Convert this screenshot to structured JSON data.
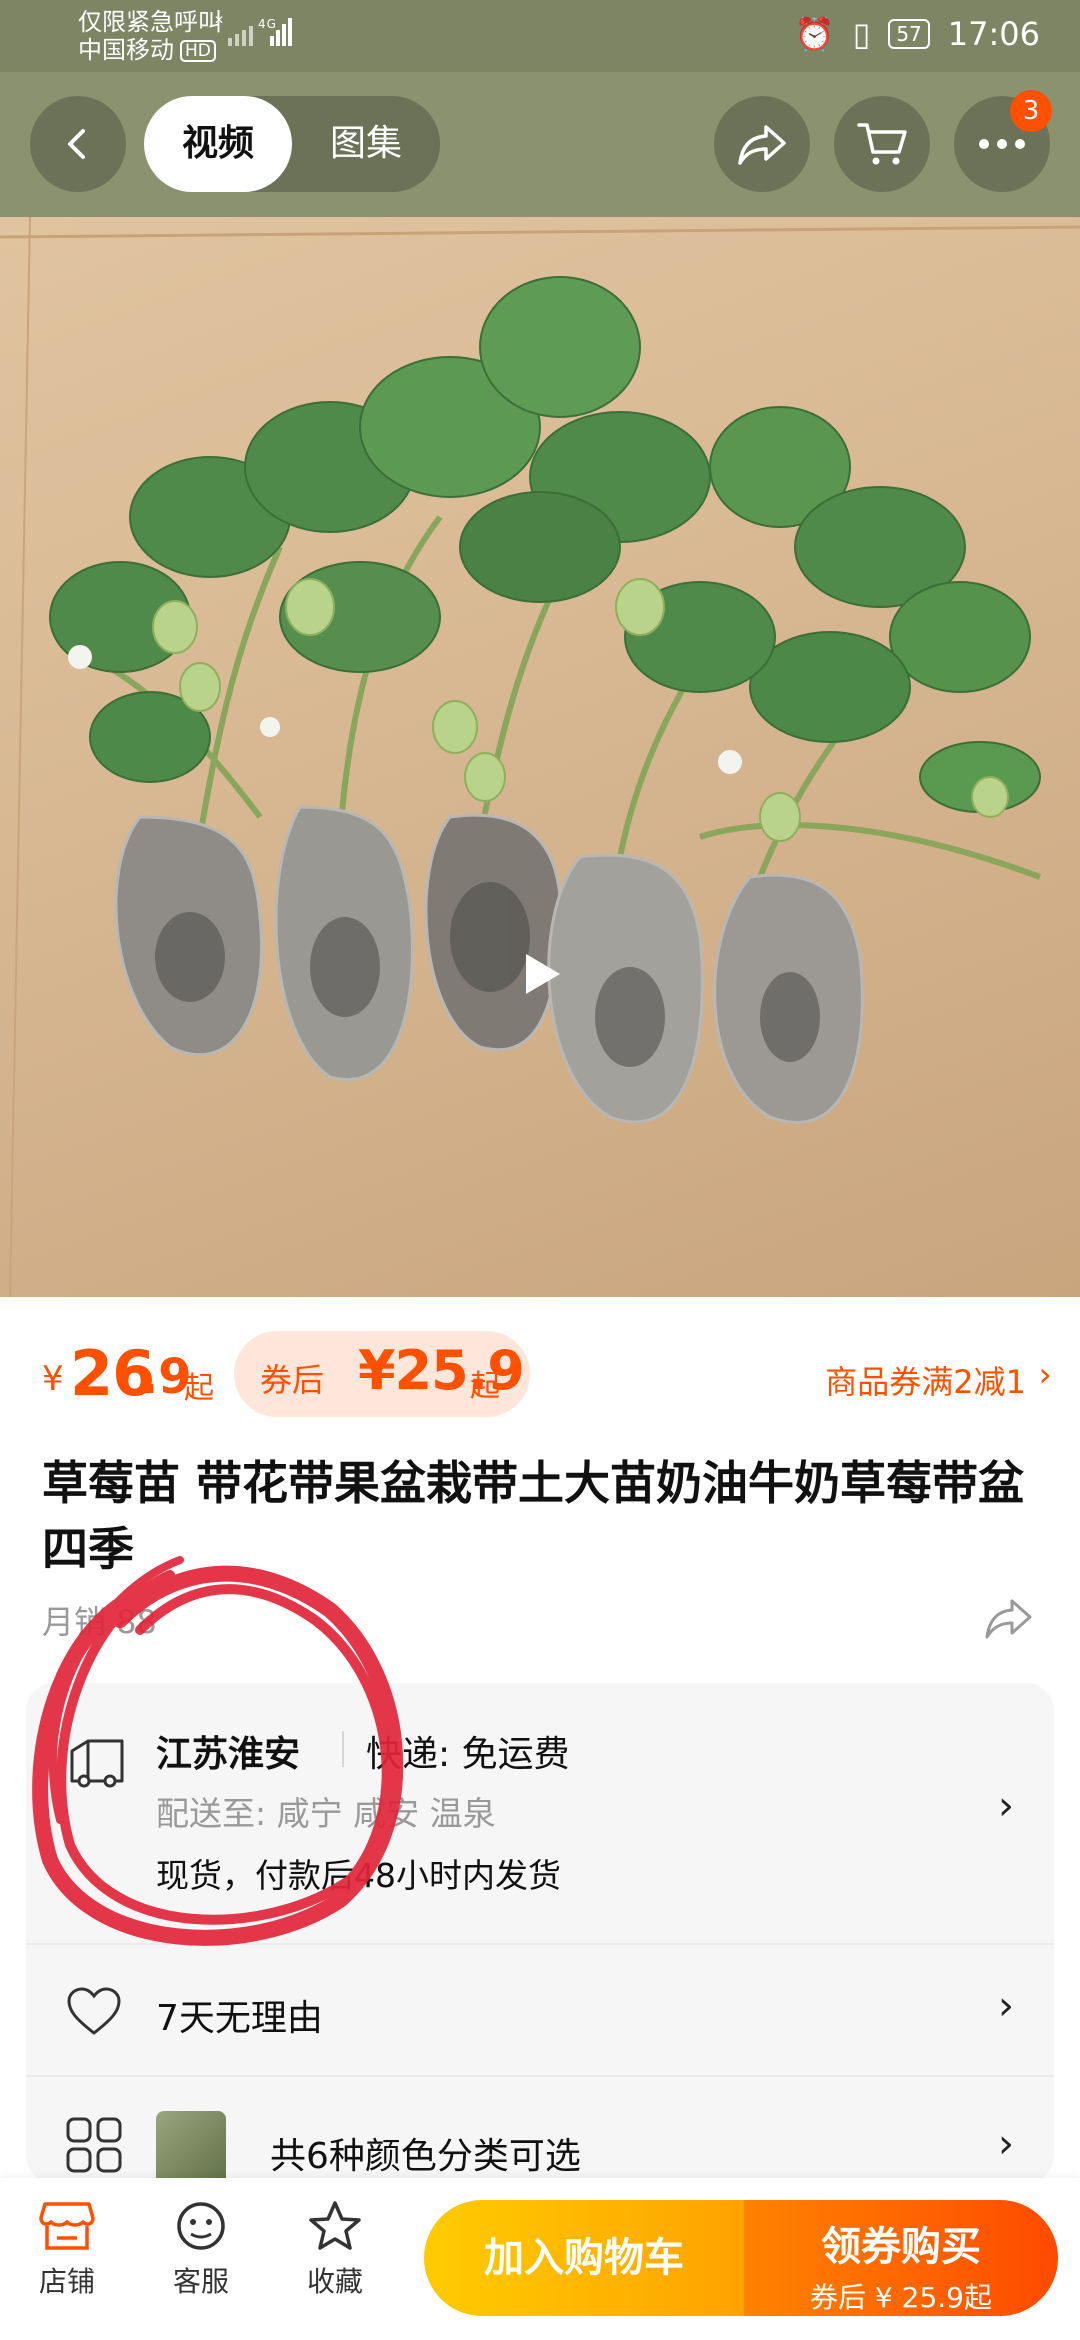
{
  "status_bar": {
    "line1": "仅限紧急呼叫",
    "carrier": "中国移动",
    "hd": "HD",
    "network": "4G",
    "battery": "57",
    "time": "17:06"
  },
  "nav": {
    "tab_video": "视频",
    "tab_gallery": "图集",
    "cart_badge": "3"
  },
  "price": {
    "currency": "¥",
    "int": "26",
    "dec": ".9",
    "qi": "起",
    "coupon_label": "券后",
    "coupon_value": "¥25.9",
    "coupon_qi": "起",
    "voucher_text": "商品券满2减1",
    "voucher_chevron": "›"
  },
  "product": {
    "title": "草莓苗 带花带果盆栽带土大苗奶油牛奶草莓带盆四季",
    "monthly_sales": "月销 88"
  },
  "shipping": {
    "origin": "江苏淮安",
    "fee": "快递: 免运费",
    "deliver_to": "配送至: 咸宁 咸安 温泉",
    "stock": "现货，付款后48小时内发货"
  },
  "returns": {
    "text": "7天无理由"
  },
  "variants": {
    "text": "共6种颜色分类可选"
  },
  "bottom": {
    "store": "店铺",
    "service": "客服",
    "favorite": "收藏",
    "add_cart": "加入购物车",
    "buy_main": "领券购买",
    "buy_sub": "券后 ¥ 25.9起"
  },
  "colors": {
    "accent": "#ff5000",
    "nav_bg": "#8b9270",
    "annotation": "#e2263a"
  }
}
